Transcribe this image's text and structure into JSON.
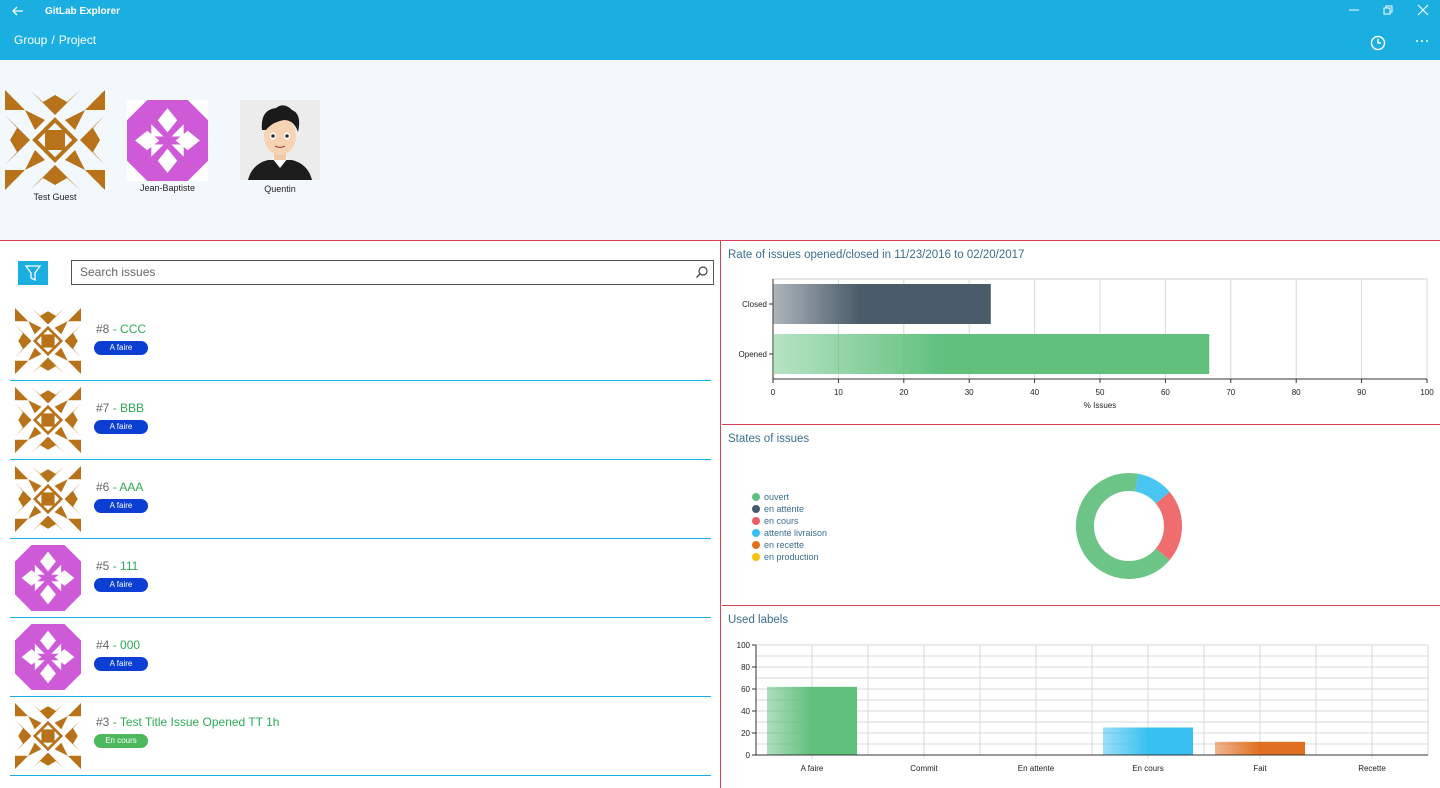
{
  "window": {
    "app_title": "GitLab Explorer",
    "back_icon": "back-arrow-icon",
    "minimize_icon": "minimize-icon",
    "restore_icon": "restore-icon",
    "close_icon": "close-icon"
  },
  "breadcrumb": {
    "group": "Group",
    "separator": "/",
    "project": "Project"
  },
  "header_actions": {
    "history_icon": "clock-icon",
    "more_icon": "more-icon"
  },
  "members": [
    {
      "name": "Test Guest",
      "avatar": "identicon-brown"
    },
    {
      "name": "Jean-Baptiste",
      "avatar": "identicon-magenta"
    },
    {
      "name": "Quentin",
      "avatar": "cartoon-portrait"
    }
  ],
  "search": {
    "placeholder": "Search issues",
    "filter_icon": "filter-icon",
    "search_icon": "search-icon"
  },
  "issues": [
    {
      "number": "#8",
      "separator": "-",
      "title": "CCC",
      "label": "A faire",
      "label_color": "#0b3fd4",
      "avatar": "identicon-brown"
    },
    {
      "number": "#7",
      "separator": "-",
      "title": "BBB",
      "label": "A faire",
      "label_color": "#0b3fd4",
      "avatar": "identicon-brown"
    },
    {
      "number": "#6",
      "separator": "-",
      "title": "AAA",
      "label": "A faire",
      "label_color": "#0b3fd4",
      "avatar": "identicon-brown"
    },
    {
      "number": "#5",
      "separator": "-",
      "title": "111",
      "label": "A faire",
      "label_color": "#0b3fd4",
      "avatar": "identicon-magenta"
    },
    {
      "number": "#4",
      "separator": "-",
      "title": "000",
      "label": "A faire",
      "label_color": "#0b3fd4",
      "avatar": "identicon-magenta"
    },
    {
      "number": "#3",
      "separator": "-",
      "title": "Test Title Issue Opened TT 1h",
      "label": "En cours",
      "label_color": "#4cb85e",
      "avatar": "identicon-brown"
    }
  ],
  "rate_panel": {
    "title": "Rate of issues opened/closed in 11/23/2016 to 02/20/2017",
    "chart_data": {
      "type": "bar",
      "orientation": "horizontal",
      "categories": [
        "Closed",
        "Opened"
      ],
      "values": [
        33.3,
        66.7
      ],
      "colors": [
        "#4a5b69",
        "#5fc07c"
      ],
      "xlabel": "% Issues",
      "xlim": [
        0,
        100
      ],
      "xticks": [
        "0",
        "10",
        "20",
        "30",
        "40",
        "50",
        "60",
        "70",
        "80",
        "90",
        "100"
      ],
      "grid": true
    }
  },
  "states_panel": {
    "title": "States of issues",
    "chart_data": {
      "type": "pie",
      "style": "donut",
      "legend": [
        {
          "name": "ouvert",
          "color": "#5fc07c"
        },
        {
          "name": "en attente",
          "color": "#46596a"
        },
        {
          "name": "en cours",
          "color": "#ee5f63"
        },
        {
          "name": "attente livraison",
          "color": "#38c1f0"
        },
        {
          "name": "en recette",
          "color": "#e07020"
        },
        {
          "name": "en production",
          "color": "#f4c20d"
        }
      ],
      "values": [
        66.7,
        0,
        22.2,
        11.1,
        0,
        0
      ],
      "legend_position": "left"
    }
  },
  "labels_panel": {
    "title": "Used labels",
    "chart_data": {
      "type": "bar",
      "categories": [
        "A faire",
        "Commit",
        "En attente",
        "En cours",
        "Fait",
        "Recette"
      ],
      "values": [
        62,
        0,
        0,
        25,
        12,
        0
      ],
      "colors": [
        "#5fc07c",
        "#5fc07c",
        "#5fc07c",
        "#38c1f0",
        "#e07020",
        "#5fc07c"
      ],
      "ylim": [
        0,
        100
      ],
      "yticks": [
        "0",
        "20",
        "40",
        "60",
        "80",
        "100"
      ],
      "grid": true
    }
  }
}
